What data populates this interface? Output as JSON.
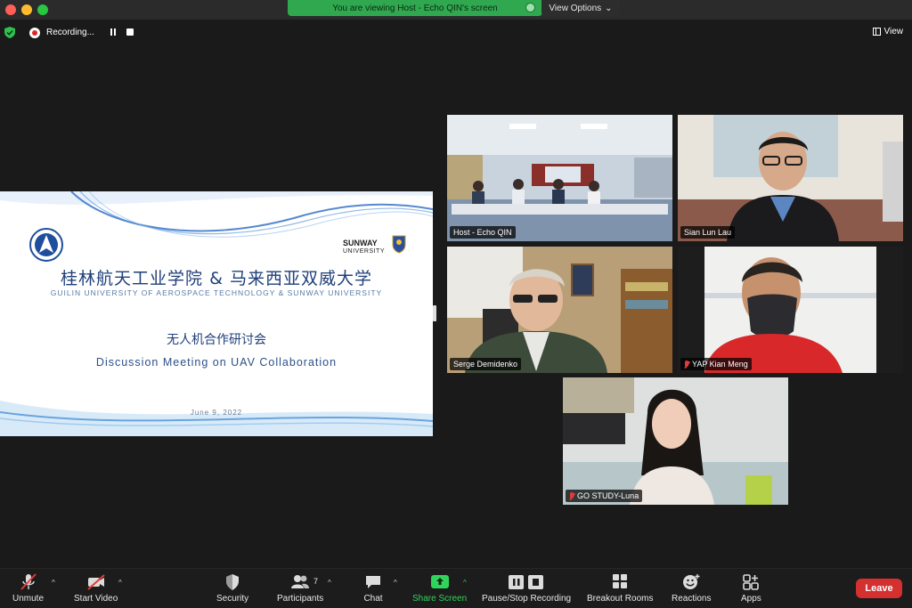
{
  "window": {
    "viewing_banner": "You are viewing Host - Echo QIN's screen",
    "view_options": "View Options"
  },
  "status": {
    "recording_label": "Recording...",
    "view_label": "View"
  },
  "slide": {
    "title_cn": "桂林航天工业学院 & 马来西亚双威大学",
    "title_en": "GUILIN UNIVERSITY OF AEROSPACE TECHNOLOGY & SUNWAY UNIVERSITY",
    "event_cn": "无人机合作研讨会",
    "event_en": "Discussion Meeting on UAV Collaboration",
    "date": "June 9, 2022",
    "sunway_brand": "SUNWAY",
    "sunway_sub": "UNIVERSITY"
  },
  "participants": [
    {
      "name": "Host - Echo QIN",
      "muted": false,
      "active": true
    },
    {
      "name": "Sian Lun Lau",
      "muted": false,
      "active": false
    },
    {
      "name": "Serge Demidenko",
      "muted": false,
      "active": false
    },
    {
      "name": "YAP Kian Meng",
      "muted": true,
      "active": false
    },
    {
      "name": "GO STUDY-Luna",
      "muted": true,
      "active": false
    }
  ],
  "toolbar": {
    "unmute": "Unmute",
    "start_video": "Start Video",
    "security": "Security",
    "participants": "Participants",
    "participant_count": "7",
    "chat": "Chat",
    "share_screen": "Share Screen",
    "pause_stop_recording": "Pause/Stop Recording",
    "breakout_rooms": "Breakout Rooms",
    "reactions": "Reactions",
    "apps": "Apps",
    "leave": "Leave"
  },
  "colors": {
    "accent_green": "#2fd45a",
    "leave_red": "#d3302f",
    "active_outline": "#33c24d"
  }
}
